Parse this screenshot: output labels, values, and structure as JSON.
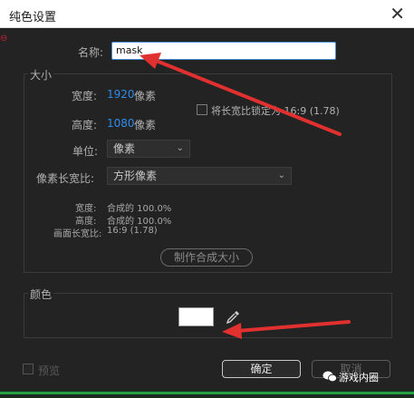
{
  "dialog": {
    "title": "纯色设置",
    "name_label": "名称:",
    "name_value": "mask"
  },
  "size": {
    "section_label": "大小",
    "width_label": "宽度:",
    "width_value": "1920",
    "width_unit": "像素",
    "height_label": "高度:",
    "height_value": "1080",
    "height_unit": "像素",
    "lock_label": "将长宽比锁定为 16:9 (1.78)",
    "units_label": "单位:",
    "units_value": "像素",
    "pixel_aspect_label": "像素长宽比:",
    "pixel_aspect_value": "方形像素",
    "info_width_label": "宽度:",
    "info_width_value": "合成的 100.0%",
    "info_height_label": "高度:",
    "info_height_value": "合成的 100.0%",
    "frame_aspect_label": "画面长宽比:",
    "frame_aspect_value": "16:9 (1.78)",
    "make_comp_size": "制作合成大小"
  },
  "color": {
    "section_label": "颜色",
    "swatch": "#ffffff"
  },
  "footer": {
    "preview_label": "预览",
    "ok": "确定",
    "cancel": "取消"
  },
  "watermark": "游戏内圈",
  "colors": {
    "accent_blue": "#2d8ceb",
    "annotation_red": "#e03030"
  }
}
